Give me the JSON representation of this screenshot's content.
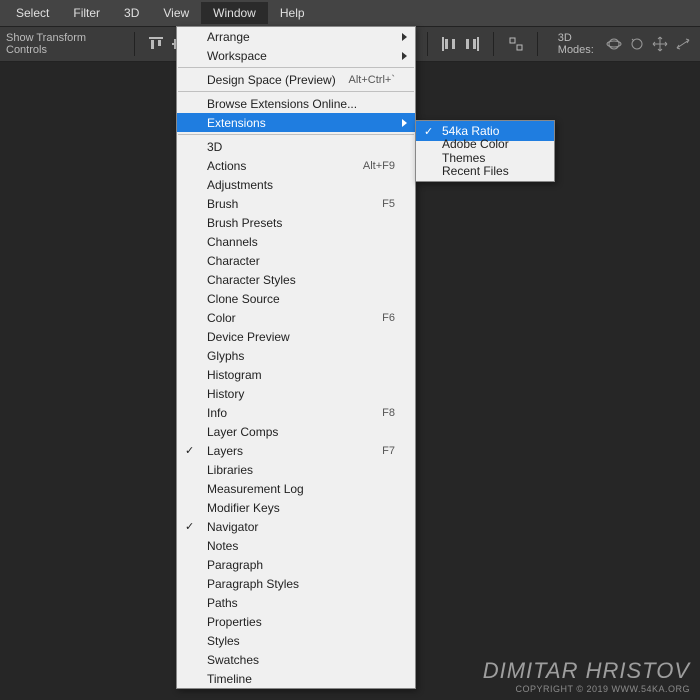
{
  "menubar": {
    "items": [
      "Select",
      "Filter",
      "3D",
      "View",
      "Window",
      "Help"
    ],
    "open_index": 4
  },
  "toolbar": {
    "transform_label": "Show Transform Controls",
    "modes_label": "3D Modes:"
  },
  "window_menu": {
    "groups": [
      [
        {
          "label": "Arrange",
          "shortcut": "",
          "sub": true
        },
        {
          "label": "Workspace",
          "shortcut": "",
          "sub": true
        }
      ],
      [
        {
          "label": "Design Space (Preview)",
          "shortcut": "Alt+Ctrl+`",
          "sub": false
        }
      ],
      [
        {
          "label": "Browse Extensions Online...",
          "shortcut": "",
          "sub": false
        },
        {
          "label": "Extensions",
          "shortcut": "",
          "sub": true,
          "highlight": true
        }
      ],
      [
        {
          "label": "3D",
          "shortcut": ""
        },
        {
          "label": "Actions",
          "shortcut": "Alt+F9"
        },
        {
          "label": "Adjustments",
          "shortcut": ""
        },
        {
          "label": "Brush",
          "shortcut": "F5"
        },
        {
          "label": "Brush Presets",
          "shortcut": ""
        },
        {
          "label": "Channels",
          "shortcut": ""
        },
        {
          "label": "Character",
          "shortcut": ""
        },
        {
          "label": "Character Styles",
          "shortcut": ""
        },
        {
          "label": "Clone Source",
          "shortcut": ""
        },
        {
          "label": "Color",
          "shortcut": "F6"
        },
        {
          "label": "Device Preview",
          "shortcut": ""
        },
        {
          "label": "Glyphs",
          "shortcut": ""
        },
        {
          "label": "Histogram",
          "shortcut": ""
        },
        {
          "label": "History",
          "shortcut": ""
        },
        {
          "label": "Info",
          "shortcut": "F8"
        },
        {
          "label": "Layer Comps",
          "shortcut": ""
        },
        {
          "label": "Layers",
          "shortcut": "F7",
          "checked": true
        },
        {
          "label": "Libraries",
          "shortcut": ""
        },
        {
          "label": "Measurement Log",
          "shortcut": ""
        },
        {
          "label": "Modifier Keys",
          "shortcut": ""
        },
        {
          "label": "Navigator",
          "shortcut": "",
          "checked": true
        },
        {
          "label": "Notes",
          "shortcut": ""
        },
        {
          "label": "Paragraph",
          "shortcut": ""
        },
        {
          "label": "Paragraph Styles",
          "shortcut": ""
        },
        {
          "label": "Paths",
          "shortcut": ""
        },
        {
          "label": "Properties",
          "shortcut": ""
        },
        {
          "label": "Styles",
          "shortcut": ""
        },
        {
          "label": "Swatches",
          "shortcut": ""
        },
        {
          "label": "Timeline",
          "shortcut": ""
        }
      ]
    ]
  },
  "extensions_submenu": {
    "items": [
      {
        "label": "54ka Ratio",
        "checked": true,
        "highlight": true
      },
      {
        "label": "Adobe Color Themes"
      },
      {
        "label": "Recent Files"
      }
    ]
  },
  "watermark": {
    "line1": "Dimitar Hristov",
    "line2": "Copyright © 2019 www.54ka.org"
  }
}
